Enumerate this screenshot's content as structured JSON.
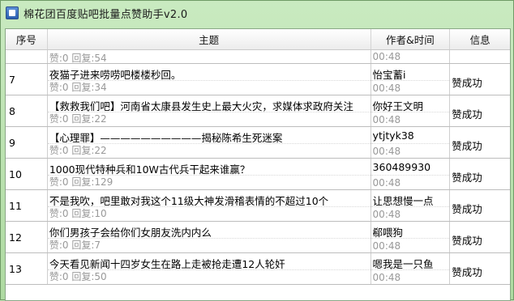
{
  "window": {
    "title": "棉花团百度贴吧批量点赞助手v2.0"
  },
  "columns": {
    "num": "序号",
    "topic": "主题",
    "author_time": "作者&时间",
    "info": "信息"
  },
  "partial_row": {
    "stats": "赞:0 回复:54",
    "time": "00:48"
  },
  "rows": [
    {
      "num": "7",
      "title": "夜猫子进来唠唠吧楼楼秒回。",
      "stats": "赞:0 回复:34",
      "author": "怡宝蓄i",
      "time": "00:48",
      "status": "赞成功"
    },
    {
      "num": "8",
      "title": "【救救我们吧】河南省太康县发生史上最大火灾，求媒体求政府关注",
      "stats": "赞:0 回复:22",
      "author": "你好王文明",
      "time": "00:48",
      "status": "赞成功"
    },
    {
      "num": "9",
      "title": "【心理罪】——————————揭秘陈希生死迷案",
      "stats": "赞:0 回复:22",
      "author": "ytjtyk38",
      "time": "00:48",
      "status": "赞成功"
    },
    {
      "num": "10",
      "title": "1000现代特种兵和10W古代兵干起来谁赢？",
      "stats": "赞:0 回复:129",
      "author": "360489930",
      "time": "00:48",
      "status": "赞成功"
    },
    {
      "num": "11",
      "title": "不是我吹，吧里敢对我这个11级大神发滑稽表情的不超过10个",
      "stats": "赞:0 回复:10",
      "author": "让思想慢一点",
      "time": "00:48",
      "status": "赞成功"
    },
    {
      "num": "12",
      "title": "你们男孩子会给你们女朋友洗内内么",
      "stats": "赞:0 回复:7",
      "author": "郗喂狗",
      "time": "00:48",
      "status": "赞成功"
    },
    {
      "num": "13",
      "title": "今天看见新闻十四岁女生在路上走被抢走遭12人轮奸",
      "stats": "赞:0 回复:50",
      "author": "嗯我是一只鱼",
      "time": "00:48",
      "status": "赞成功"
    }
  ]
}
